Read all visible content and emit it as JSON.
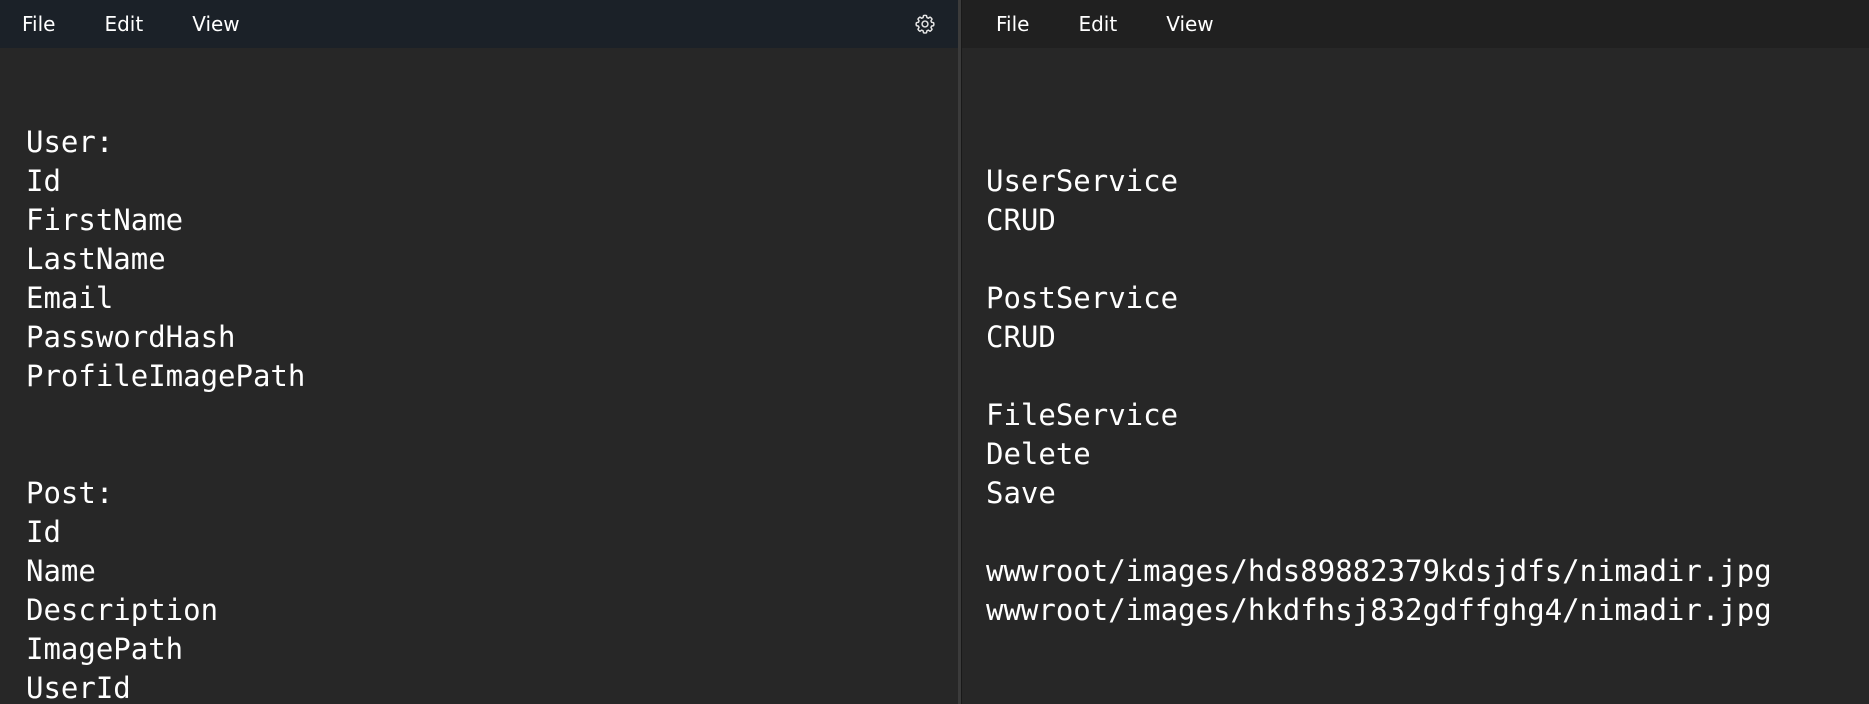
{
  "left_window": {
    "menu": [
      "File",
      "Edit",
      "View"
    ],
    "settings_icon": "gear-icon",
    "lines": [
      "User:",
      "Id",
      "FirstName",
      "LastName",
      "Email",
      "PasswordHash",
      "ProfileImagePath",
      "",
      "",
      "Post:",
      "Id",
      "Name",
      "Description",
      "ImagePath",
      "UserId"
    ]
  },
  "right_window": {
    "menu": [
      "File",
      "Edit",
      "View"
    ],
    "lines": [
      "UserService",
      "CRUD",
      "",
      "PostService",
      "CRUD",
      "",
      "FileService",
      "Delete",
      "Save",
      "",
      "wwwroot/images/hds89882379kdsjdfs/nimadir.jpg",
      "wwwroot/images/hkdfhsj832gdffghg4/nimadir.jpg"
    ]
  },
  "colors": {
    "editor_bg": "#272727",
    "left_menubar_bg": "#1b2128",
    "right_menubar_bg": "#202020",
    "text": "#ffffff"
  }
}
